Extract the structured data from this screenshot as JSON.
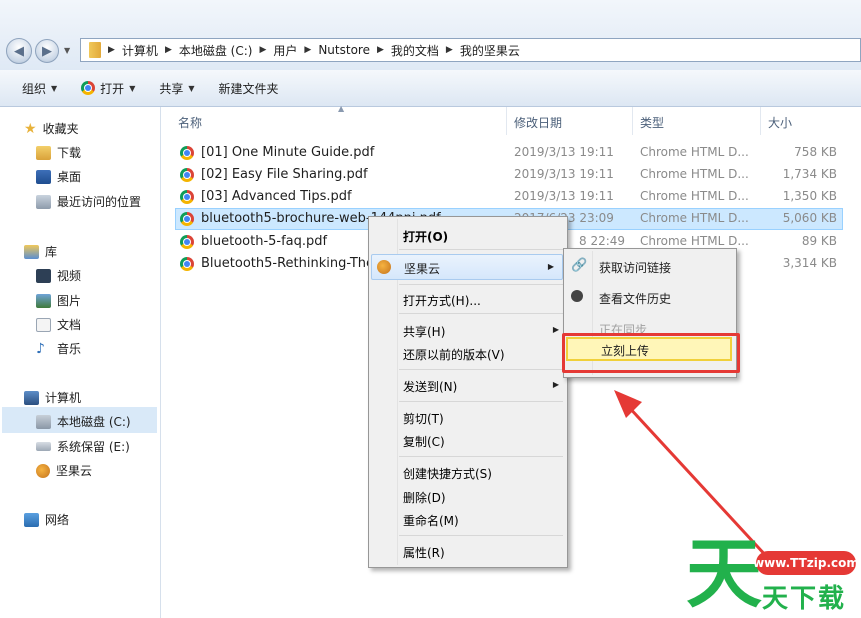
{
  "breadcrumbs": [
    "计算机",
    "本地磁盘 (C:)",
    "用户",
    "Nutstore",
    "我的文档",
    "我的坚果云"
  ],
  "toolbar": {
    "organize": "组织",
    "open": "打开",
    "share": "共享",
    "new_folder": "新建文件夹"
  },
  "sidebar": {
    "favorites": "收藏夹",
    "downloads": "下载",
    "desktop": "桌面",
    "recent": "最近访问的位置",
    "libraries": "库",
    "videos": "视频",
    "pictures": "图片",
    "documents": "文档",
    "music": "音乐",
    "computer": "计算机",
    "local_disk": "本地磁盘 (C:)",
    "reserved": "系统保留 (E:)",
    "nutstore": "坚果云",
    "network": "网络"
  },
  "columns": {
    "name": "名称",
    "date": "修改日期",
    "type": "类型",
    "size": "大小"
  },
  "files": [
    {
      "name": "[01] One Minute Guide.pdf",
      "date": "2019/3/13 19:11",
      "type": "Chrome HTML D...",
      "size": "758 KB"
    },
    {
      "name": "[02] Easy File Sharing.pdf",
      "date": "2019/3/13 19:11",
      "type": "Chrome HTML D...",
      "size": "1,734 KB"
    },
    {
      "name": "[03] Advanced Tips.pdf",
      "date": "2019/3/13 19:11",
      "type": "Chrome HTML D...",
      "size": "1,350 KB"
    },
    {
      "name": "bluetooth5-brochure-web-144ppi.pdf",
      "date": "2017/6/23 23:09",
      "type": "Chrome HTML D...",
      "size": "5,060 KB"
    },
    {
      "name": "bluetooth-5-faq.pdf",
      "date": "8 22:49",
      "type": "Chrome HTML D...",
      "size": "89 KB"
    },
    {
      "name": "Bluetooth5-Rethinking-The",
      "date": "",
      "type": "",
      "size": "3,314 KB"
    }
  ],
  "context_menu": {
    "open": "打开(O)",
    "nutstore": "坚果云",
    "open_with": "打开方式(H)...",
    "share": "共享(H)",
    "restore": "还原以前的版本(V)",
    "send_to": "发送到(N)",
    "cut": "剪切(T)",
    "copy": "复制(C)",
    "create_shortcut": "创建快捷方式(S)",
    "delete": "删除(D)",
    "rename": "重命名(M)",
    "properties": "属性(R)"
  },
  "submenu": {
    "get_link": "获取访问链接",
    "history": "查看文件历史",
    "syncing": "正在同步",
    "upload_now": "立刻上传"
  },
  "watermark": {
    "site": "www.TTzip.com",
    "brand": "天下载",
    "big_char": "天"
  },
  "colors": {
    "highlight": "#e53935",
    "selection": "#cce8ff",
    "watermark_green": "#22b14c"
  }
}
